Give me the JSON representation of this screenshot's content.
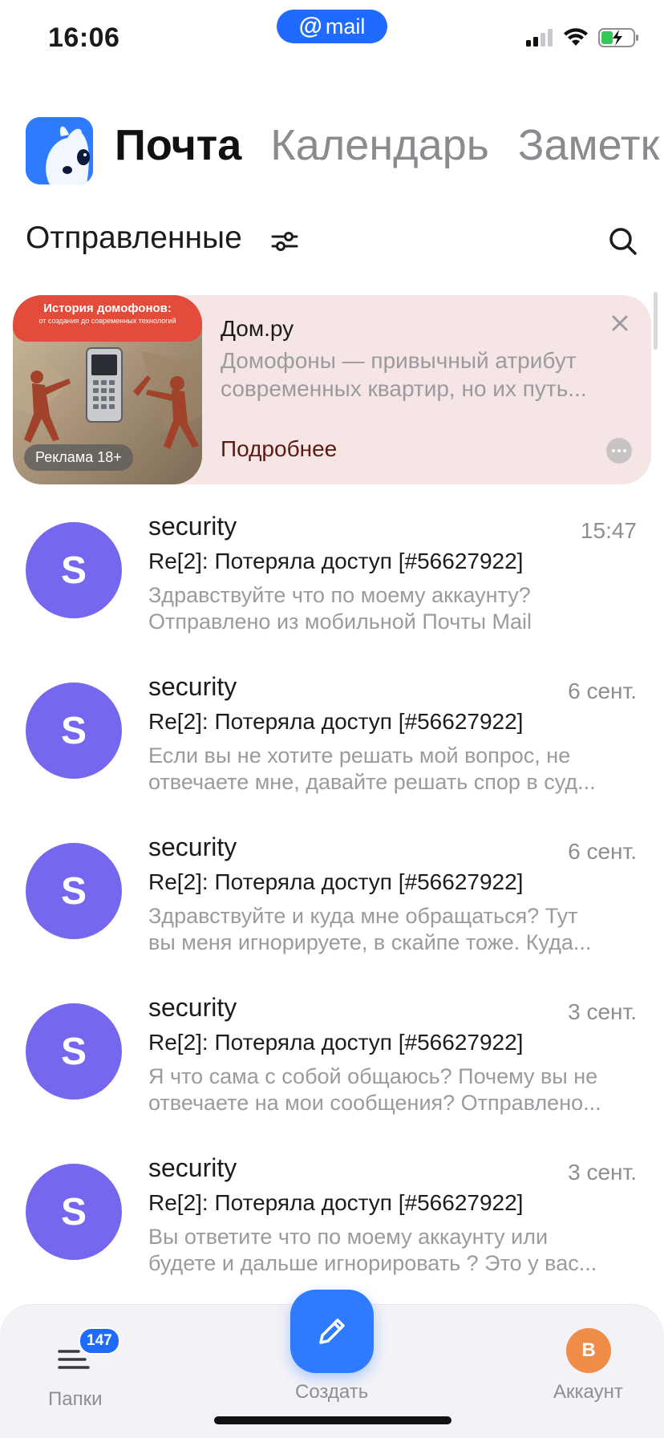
{
  "status_bar": {
    "time": "16:06",
    "center_pill": {
      "icon": "@",
      "label": "mail"
    }
  },
  "header": {
    "tabs": [
      {
        "label": "Почта",
        "active": true
      },
      {
        "label": "Календарь",
        "active": false
      },
      {
        "label": "Заметк",
        "active": false
      }
    ]
  },
  "folder": {
    "title": "Отправленные"
  },
  "ad": {
    "banner_title": "История домофонов:",
    "banner_subtitle": "от создания до современных технологий",
    "badge": "Реклама 18+",
    "advertiser": "Дом.ру",
    "text_line1": "Домофоны — привычный атрибут",
    "text_line2": "современных квартир, но их путь...",
    "more_label": "Подробнее"
  },
  "messages": [
    {
      "avatar_letter": "S",
      "sender": "security",
      "date": "15:47",
      "subject": "Re[2]: Потеряла доступ [#56627922]",
      "snippet_line1": "Здравствуйте что по моему аккаунту?",
      "snippet_line2": "Отправлено из мобильной Почты Mail"
    },
    {
      "avatar_letter": "S",
      "sender": "security",
      "date": "6 сент.",
      "subject": "Re[2]: Потеряла доступ [#56627922]",
      "snippet_line1": "Если вы не хотите решать мой вопрос, не",
      "snippet_line2": "отвечаете мне, давайте решать спор в суд..."
    },
    {
      "avatar_letter": "S",
      "sender": "security",
      "date": "6 сент.",
      "subject": "Re[2]: Потеряла доступ [#56627922]",
      "snippet_line1": "Здравствуйте и куда мне обращаться? Тут",
      "snippet_line2": "вы меня игнорируете, в скайпе тоже. Куда..."
    },
    {
      "avatar_letter": "S",
      "sender": "security",
      "date": "3 сент.",
      "subject": "Re[2]: Потеряла доступ [#56627922]",
      "snippet_line1": "Я что сама с собой общаюсь? Почему вы не",
      "snippet_line2": "отвечаете на мои сообщения? Отправлено..."
    },
    {
      "avatar_letter": "S",
      "sender": "security",
      "date": "3 сент.",
      "subject": "Re[2]: Потеряла доступ [#56627922]",
      "snippet_line1": "Вы ответите что по моему аккаунту или",
      "snippet_line2": "будете и дальше игнорировать ? Это у вас..."
    }
  ],
  "bottom_nav": {
    "folders_label": "Папки",
    "folders_badge": "147",
    "compose_label": "Создать",
    "account_label": "Аккаунт",
    "account_letter": "B"
  },
  "colors": {
    "accent": "#1f6bff",
    "avatar": "#7568ee",
    "ad_background": "#f5e6e5",
    "account_avatar": "#ef8d48"
  }
}
